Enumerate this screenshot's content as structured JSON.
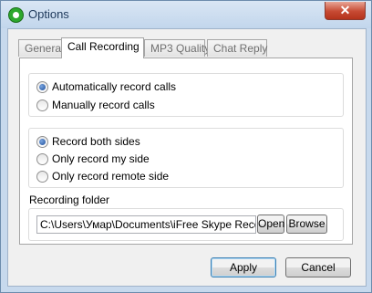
{
  "window": {
    "title": "Options",
    "close_glyph": "✕"
  },
  "tabs": [
    {
      "label": "General",
      "active": false
    },
    {
      "label": "Call Recording",
      "active": true
    },
    {
      "label": "MP3 Quality",
      "active": false
    },
    {
      "label": "Chat Reply",
      "active": false
    }
  ],
  "record_mode": {
    "options": [
      "Automatically record calls",
      "Manually record calls"
    ],
    "selected": "Automatically record calls"
  },
  "record_sides": {
    "options": [
      "Record both sides",
      "Only record my side",
      "Only record remote side"
    ],
    "selected": "Record both sides"
  },
  "folder": {
    "caption": "Recording folder",
    "path": "C:\\Users\\Умар\\Documents\\iFree Skype Recorder",
    "open_label": "Open",
    "browse_label": "Browse"
  },
  "buttons": {
    "apply": "Apply",
    "cancel": "Cancel"
  }
}
